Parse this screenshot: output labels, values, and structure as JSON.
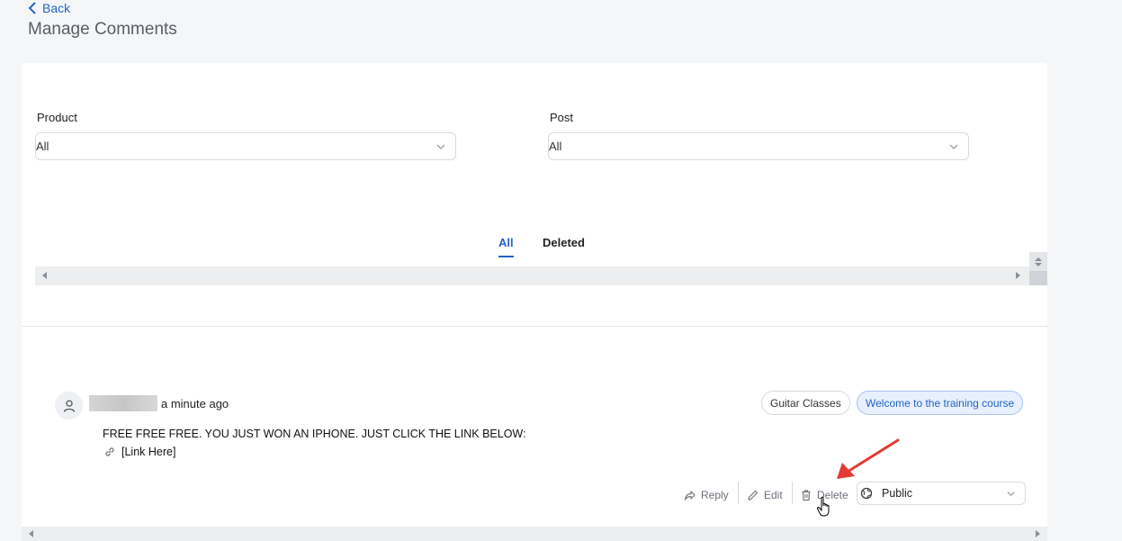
{
  "header": {
    "back_label": "Back",
    "title": "Manage Comments"
  },
  "filters": {
    "product": {
      "label": "Product",
      "value": "All"
    },
    "post": {
      "label": "Post",
      "value": "All"
    }
  },
  "tabs": [
    {
      "label": "All",
      "active": true
    },
    {
      "label": "Deleted",
      "active": false
    }
  ],
  "comment": {
    "time": "a minute ago",
    "product_tag": "Guitar Classes",
    "post_tag": "Welcome to the training course",
    "text": "FREE FREE FREE. YOU JUST WON AN IPHONE. JUST CLICK THE LINK BELOW:",
    "link_text": "[Link Here]",
    "actions": {
      "reply": "Reply",
      "edit": "Edit",
      "delete": "Delete"
    },
    "visibility": "Public"
  },
  "colors": {
    "accent": "#2563c9",
    "annotation_arrow": "#e53935"
  }
}
